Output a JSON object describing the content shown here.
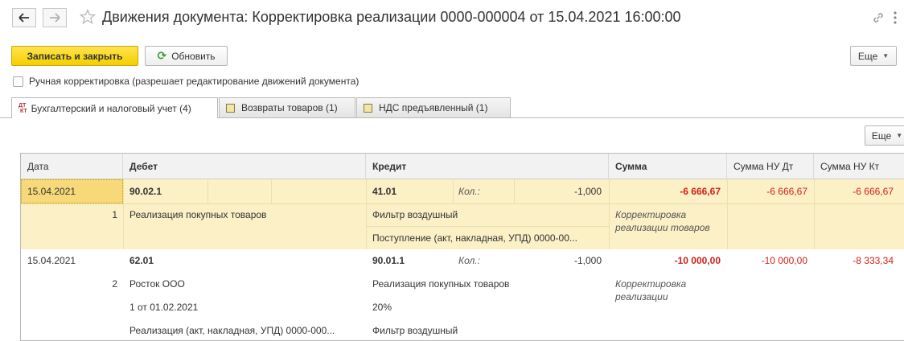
{
  "window": {
    "title": "Движения документа: Корректировка реализации 0000-000004 от 15.04.2021 16:00:00"
  },
  "toolbar": {
    "save_close": "Записать и закрыть",
    "refresh": "Обновить",
    "more": "Еще"
  },
  "manual_adjust": {
    "label": "Ручная корректировка (разрешает редактирование движений документа)",
    "checked": false
  },
  "tabs": [
    {
      "label": "Бухгалтерский и налоговый учет (4)",
      "icon": "dt-kt-icon",
      "active": true
    },
    {
      "label": "Возвраты товаров (1)",
      "icon": "register-icon",
      "active": false
    },
    {
      "label": "НДС предъявленный (1)",
      "icon": "register-icon",
      "active": false
    }
  ],
  "table_toolbar": {
    "more": "Еще"
  },
  "table": {
    "columns": [
      "Дата",
      "Дебет",
      "Кредит",
      "Сумма",
      "Сумма НУ Дт",
      "Сумма НУ Кт"
    ],
    "rows": [
      {
        "date": "15.04.2021",
        "num": "1",
        "debit_account": "90.02.1",
        "debit_lines": [
          "Реализация покупных товаров"
        ],
        "credit_account": "41.01",
        "credit_qty_label": "Кол.:",
        "credit_qty": "-1,000",
        "credit_lines": [
          "Фильтр воздушный",
          "Поступление (акт, накладная, УПД) 0000-00..."
        ],
        "sum": "-6 666,67",
        "sum_comment": [
          "Корректировка",
          "реализации товаров"
        ],
        "sum_nu_dt": "-6 666,67",
        "sum_nu_kt": "-6 666,67"
      },
      {
        "date": "15.04.2021",
        "num": "2",
        "debit_account": "62.01",
        "debit_lines": [
          "Росток ООО",
          "1 от 01.02.2021",
          "Реализация (акт, накладная, УПД) 0000-000..."
        ],
        "credit_account": "90.01.1",
        "credit_qty_label": "Кол.:",
        "credit_qty": "-1,000",
        "credit_lines": [
          "Реализация покупных товаров",
          "20%",
          "Фильтр воздушный"
        ],
        "sum": "-10 000,00",
        "sum_comment": [
          "Корректировка",
          "реализации"
        ],
        "sum_nu_dt": "-10 000,00",
        "sum_nu_kt": "-8 333,34"
      }
    ]
  },
  "colors": {
    "primary_button": "#f5cf00",
    "selected_row": "#fbf0c6",
    "negative": "#d0201a"
  }
}
